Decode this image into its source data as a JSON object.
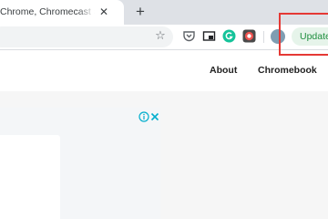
{
  "browser": {
    "tab": {
      "title": "Chrome, Chromecast and Chrome",
      "close_glyph": "✕"
    },
    "new_tab_glyph": "+",
    "toolbar": {
      "bookmark_glyph": "☆",
      "extensions": [
        "pocket-icon",
        "picture-in-picture-icon",
        "grammarly-icon",
        "screen-recorder-icon"
      ],
      "update_label": "Update"
    }
  },
  "site": {
    "nav": {
      "about": "About",
      "chromebook": "Chromebook"
    }
  },
  "ad": {
    "icons": [
      "adchoices-info-icon",
      "ad-close-icon"
    ]
  },
  "colors": {
    "tabstrip_bg": "#dee1e6",
    "update_green": "#1e8e3e",
    "highlight_red": "#e53935",
    "grammarly": "#15c39a",
    "adchoices_blue": "#00aecd"
  }
}
